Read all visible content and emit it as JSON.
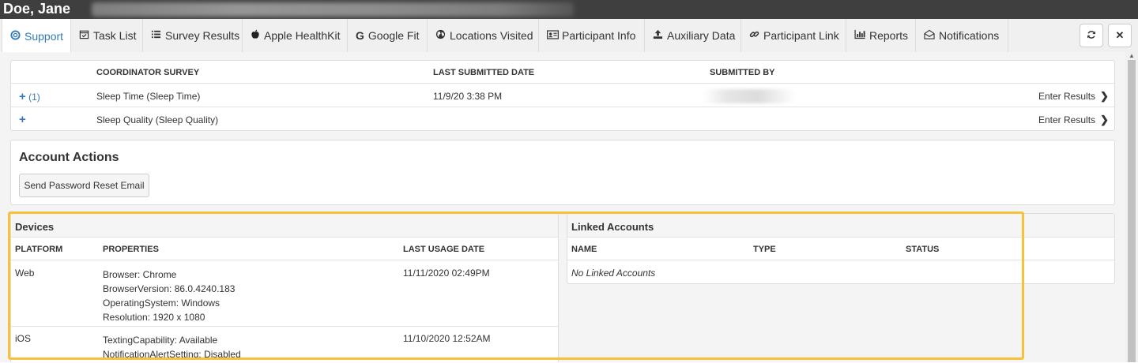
{
  "window": {
    "title": "Doe, Jane"
  },
  "tabs": [
    {
      "label": "Support",
      "icon": "lifering-icon"
    },
    {
      "label": "Task List",
      "icon": "calendar-check-icon"
    },
    {
      "label": "Survey Results",
      "icon": "list-icon"
    },
    {
      "label": "Apple HealthKit",
      "icon": "apple-icon"
    },
    {
      "label": "Google Fit",
      "icon": "google-icon"
    },
    {
      "label": "Locations Visited",
      "icon": "globe-icon"
    },
    {
      "label": "Participant Info",
      "icon": "id-card-icon"
    },
    {
      "label": "Auxiliary Data",
      "icon": "upload-icon"
    },
    {
      "label": "Participant Link",
      "icon": "link-icon"
    },
    {
      "label": "Reports",
      "icon": "bar-chart-icon"
    },
    {
      "label": "Notifications",
      "icon": "envelope-open-icon"
    }
  ],
  "tab_actions": {
    "refresh_icon": "refresh-icon",
    "close_icon": "close-icon"
  },
  "survey_table": {
    "headers": [
      "COORDINATOR SURVEY",
      "LAST SUBMITTED DATE",
      "SUBMITTED BY"
    ],
    "rows": [
      {
        "expander": "(1)",
        "survey": "Sleep Time (Sleep Time)",
        "date": "11/9/20 3:38 PM",
        "action": "Enter Results"
      },
      {
        "expander": "",
        "survey": "Sleep Quality (Sleep Quality)",
        "date": "",
        "action": "Enter Results"
      }
    ]
  },
  "account_actions": {
    "title": "Account Actions",
    "reset_button": "Send Password Reset Email"
  },
  "devices": {
    "title": "Devices",
    "headers": [
      "PLATFORM",
      "PROPERTIES",
      "LAST USAGE DATE"
    ],
    "rows": [
      {
        "platform": "Web",
        "properties": [
          "Browser: Chrome",
          "BrowserVersion: 86.0.4240.183",
          "OperatingSystem: Windows",
          "Resolution: 1920 x 1080"
        ],
        "date": "11/11/2020 02:49PM"
      },
      {
        "platform": "iOS",
        "properties": [
          "TextingCapability: Available",
          "NotificationAlertSetting: Disabled"
        ],
        "date": "11/10/2020 12:52AM"
      }
    ]
  },
  "linked_accounts": {
    "title": "Linked Accounts",
    "headers": [
      "NAME",
      "TYPE",
      "STATUS"
    ],
    "empty_text": "No Linked Accounts"
  },
  "colors": {
    "accent": "#337ab7",
    "highlight": "#f7c13b",
    "titlebar": "#3f3f3f"
  }
}
